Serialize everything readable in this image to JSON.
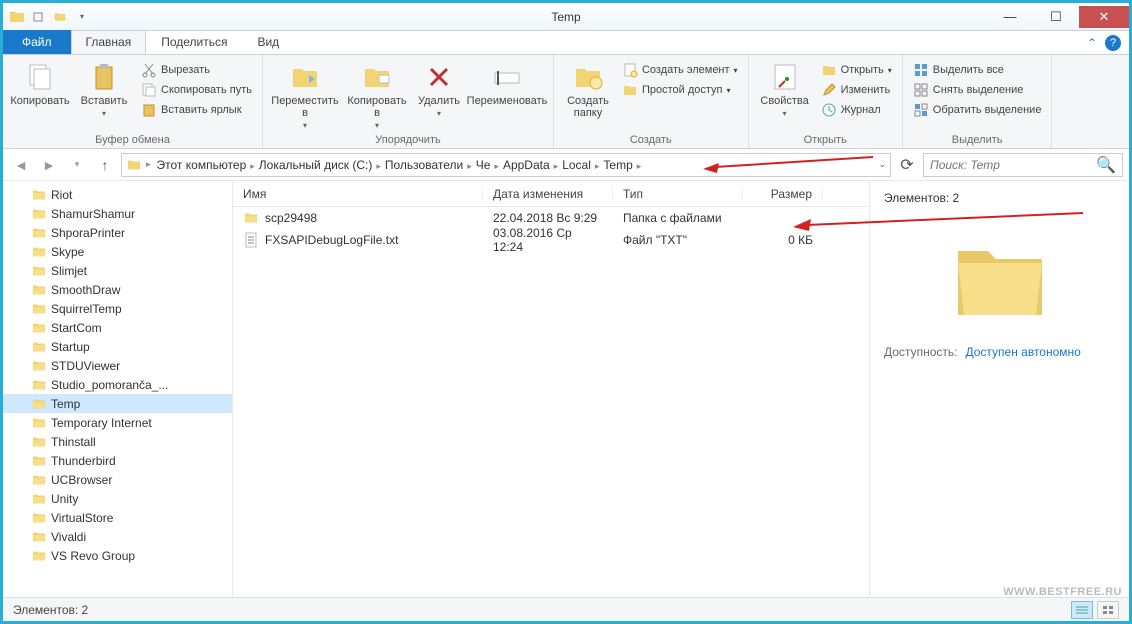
{
  "title": "Temp",
  "tabs": {
    "file": "Файл",
    "main": "Главная",
    "share": "Поделиться",
    "view": "Вид"
  },
  "ribbon": {
    "clipboard": {
      "label": "Буфер обмена",
      "copy": "Копировать",
      "paste": "Вставить",
      "cut": "Вырезать",
      "copypath": "Скопировать путь",
      "pasteshortcut": "Вставить ярлык"
    },
    "organize": {
      "label": "Упорядочить",
      "moveto": "Переместить в",
      "copyto": "Копировать в",
      "delete": "Удалить",
      "rename": "Переименовать"
    },
    "create": {
      "label": "Создать",
      "newfolder": "Создать папку",
      "newitem": "Создать элемент",
      "easyaccess": "Простой доступ"
    },
    "open": {
      "label": "Открыть",
      "properties": "Свойства",
      "openbtn": "Открыть",
      "edit": "Изменить",
      "history": "Журнал"
    },
    "select": {
      "label": "Выделить",
      "selectall": "Выделить все",
      "selectnone": "Снять выделение",
      "invert": "Обратить выделение"
    }
  },
  "breadcrumb": [
    "Этот компьютер",
    "Локальный диск (C:)",
    "Пользователи",
    "Че",
    "AppData",
    "Local",
    "Temp"
  ],
  "search_placeholder": "Поиск: Temp",
  "columns": {
    "name": "Имя",
    "date": "Дата изменения",
    "type": "Тип",
    "size": "Размер"
  },
  "tree": [
    "Riot",
    "ShamurShamur",
    "ShporaPrinter",
    "Skype",
    "Slimjet",
    "SmoothDraw",
    "SquirrelTemp",
    "StartCom",
    "Startup",
    "STDUViewer",
    "Studio_pomoranča_...",
    "Temp",
    "Temporary Internet",
    "Thinstall",
    "Thunderbird",
    "UCBrowser",
    "Unity",
    "VirtualStore",
    "Vivaldi",
    "VS Revo Group"
  ],
  "tree_selected": "Temp",
  "files": [
    {
      "name": "scp29498",
      "date": "22.04.2018 Вс 9:29",
      "type": "Папка с файлами",
      "size": "",
      "icon": "folder"
    },
    {
      "name": "FXSAPIDebugLogFile.txt",
      "date": "03.08.2016 Ср 12:24",
      "type": "Файл \"TXT\"",
      "size": "0 КБ",
      "icon": "txt"
    }
  ],
  "preview": {
    "title": "Элементов: 2",
    "avail_k": "Доступность:",
    "avail_v": "Доступен автономно"
  },
  "status": "Элементов: 2",
  "watermark": "WWW.BESTFREE.RU"
}
